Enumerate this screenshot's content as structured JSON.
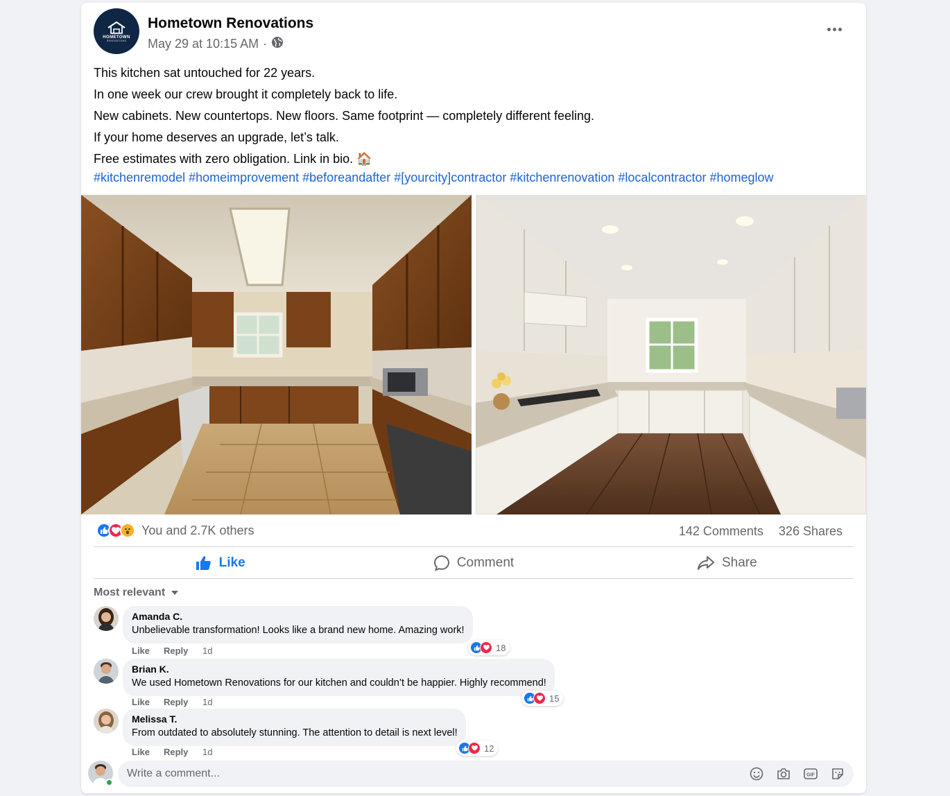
{
  "post": {
    "page_name": "Hometown Renovations",
    "logo_text": "HOMETOWN",
    "logo_subtext": "RENOVATIONS",
    "timestamp": "May 29 at 10:15 AM",
    "separator": "·",
    "audience_icon": "globe-icon",
    "lines": [
      "This kitchen sat untouched for 22 years.",
      "In one week our crew brought it completely back to life.",
      "New cabinets. New countertops. New floors. Same footprint — completely different feeling.",
      "If your home deserves an upgrade, let’s talk.",
      "Free estimates with zero obligation. Link in bio. 🏠"
    ],
    "hashtags": "#kitchenremodel #homeimprovement #beforeandafter #[yourcity]contractor #kitchenrenovation #localcontractor #homeglow"
  },
  "photos": {
    "before_icon": "kitchen-before-photo",
    "after_icon": "kitchen-after-photo"
  },
  "engagement": {
    "reaction_icons": [
      "like-reaction-icon",
      "love-reaction-icon",
      "wow-reaction-icon"
    ],
    "reaction_text": "You and 2.7K others",
    "comments_count": "142 Comments",
    "shares_count": "326 Shares"
  },
  "actions": {
    "like": "Like",
    "comment": "Comment",
    "share": "Share"
  },
  "comments_section": {
    "sort_label": "Most relevant",
    "like_label": "Like",
    "reply_label": "Reply",
    "items": [
      {
        "name": "Amanda C.",
        "text": "Unbelievable transformation! Looks like a brand new home. Amazing work!",
        "time": "1d",
        "reactions": "18"
      },
      {
        "name": "Brian K.",
        "text": "We used Hometown Renovations for our kitchen and couldn’t be happier. Highly recommend!",
        "time": "1d",
        "reactions": "15"
      },
      {
        "name": "Melissa T.",
        "text": "From outdated to absolutely stunning. The attention to detail is next level!",
        "time": "1d",
        "reactions": "12"
      }
    ]
  },
  "composer": {
    "placeholder": "Write a comment...",
    "tools": [
      "emoji-icon",
      "camera-icon",
      "gif-icon",
      "sticker-icon"
    ]
  },
  "colors": {
    "accent": "#1877f2",
    "hashtag": "#1b63d6",
    "secondary_text": "#65676b",
    "love": "#f02849",
    "wow": "#f7b125",
    "logo_bg": "#0f2645"
  }
}
